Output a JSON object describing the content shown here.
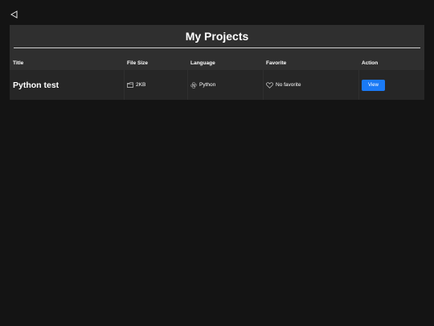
{
  "header": {
    "back_icon": "back-triangle-icon"
  },
  "panel": {
    "title": "My Projects"
  },
  "table": {
    "columns": {
      "title": "Title",
      "file_size": "File Size",
      "language": "Language",
      "favorite": "Favorite",
      "action": "Action"
    },
    "rows": [
      {
        "title": "Python test",
        "file_size": "2KB",
        "file_icon": "folder-icon",
        "language": "Python",
        "language_icon": "python-icon",
        "favorite": "No favorite",
        "favorite_icon": "heart-outline-icon",
        "action_label": "View"
      }
    ]
  },
  "colors": {
    "background": "#141414",
    "panel": "#2f2f2f",
    "row": "#262626",
    "accent": "#1a7af6"
  }
}
